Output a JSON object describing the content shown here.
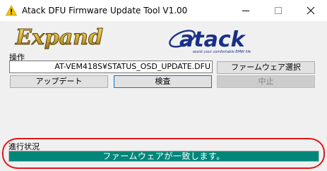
{
  "window": {
    "title": "Atack DFU Firmware Update Tool V1.00",
    "app_icon": "warning-triangle-icon",
    "controls": {
      "minimize_icon": "minimize-icon",
      "maximize_icon": "maximize-icon",
      "close_icon": "close-icon"
    }
  },
  "logos": {
    "left": "Expand",
    "right": "atack",
    "right_tagline": "assist your comfortable BMW life"
  },
  "operation": {
    "label": "操作",
    "file_path": "AT-VEM418S¥STATUS_OSD_UPDATE.DFU",
    "select_button": "ファームウェア選択",
    "update_button": "アップデート",
    "verify_button": "検査",
    "stop_button": "中止"
  },
  "progress": {
    "label": "進行状況",
    "value": 1.0,
    "message": "ファームウェアが一致します。"
  },
  "colors": {
    "progress_fill": "#00877a",
    "highlight": "#e0161b",
    "logo_gold": "#d9b13a",
    "logo_navy": "#1a2f86"
  }
}
